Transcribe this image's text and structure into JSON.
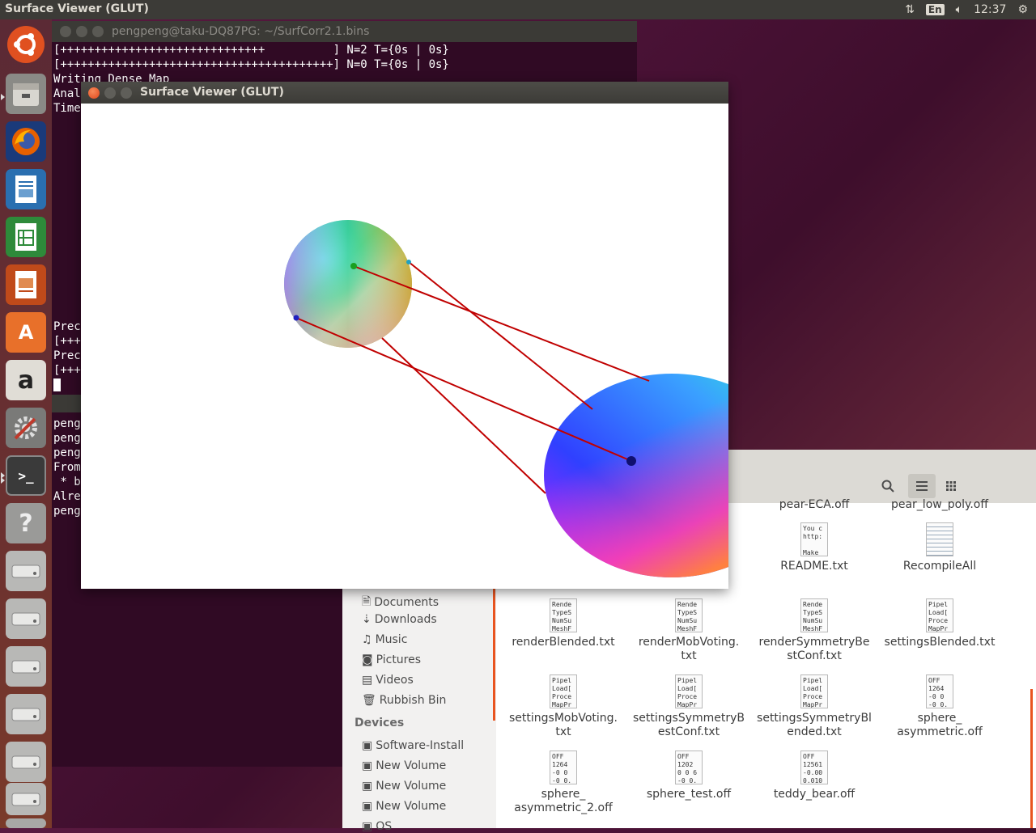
{
  "top_panel": {
    "title": "Surface Viewer (GLUT)",
    "keyboard_layout": "En",
    "time": "12:37"
  },
  "launcher": {
    "items": [
      "Ubuntu",
      "Files",
      "Firefox",
      "Writer",
      "Calc",
      "Impress",
      "Software Center",
      "Amazon",
      "System Settings",
      "Terminal",
      "Help",
      "Drive",
      "Drive",
      "Drive",
      "Drive",
      "Drive",
      "Drive",
      "Rubbish Bin"
    ]
  },
  "terminal": {
    "title": "pengpeng@taku-DQ87PG: ~/SurfCorr2.1.bins",
    "lines": [
      "[++++++++++++++++++++++++++++++          ] N=2 T={0s | 0s}",
      "[++++++++++++++++++++++++++++++++++++++++] N=0 T={0s | 0s}",
      "Writing Dense Map",
      "Anal",
      "Time"
    ],
    "lines_lower": [
      "Prec",
      "[+++",
      "Prec",
      "[+++"
    ],
    "terminal2_lines": [
      "peng",
      "peng",
      "peng",
      "From",
      " * b",
      "Alre",
      "peng"
    ]
  },
  "viewer": {
    "title": "Surface Viewer (GLUT)"
  },
  "files": {
    "sidebar": {
      "places": [
        "Documents",
        "Downloads",
        "Music",
        "Pictures",
        "Videos",
        "Rubbish Bin"
      ],
      "devices_heading": "Devices",
      "devices": [
        "Software-Install",
        "New Volume",
        "New Volume",
        "New Volume",
        "OS"
      ]
    },
    "partial_label": "y.",
    "items": [
      {
        "name": "pear-ECA.off",
        "thumb": ""
      },
      {
        "name": "pear_low_poly.off",
        "thumb": ""
      },
      {
        "name": "README.txt",
        "thumb": "You c\nhttp:\n\nMake"
      },
      {
        "name": "RecompileAll",
        "thumb": ""
      },
      {
        "name": "renderBlended.txt",
        "thumb": "Rende\nTypeS\nNumSu\nMeshF"
      },
      {
        "name": "renderMobVoting.\ntxt",
        "thumb": "Rende\nTypeS\nNumSu\nMeshF"
      },
      {
        "name": "renderSymmetryBe\nstConf.txt",
        "thumb": "Rende\nTypeS\nNumSu\nMeshF"
      },
      {
        "name": "settingsBlended.txt",
        "thumb": "Pipel\nLoad[\nProce\nMapPr"
      },
      {
        "name": "settingsMobVoting.\ntxt",
        "thumb": "Pipel\nLoad[\nProce\nMapPr"
      },
      {
        "name": "settingsSymmetryB\nestConf.txt",
        "thumb": "Pipel\nLoad[\nProce\nMapPr"
      },
      {
        "name": "settingsSymmetryBl\nended.txt",
        "thumb": "Pipel\nLoad[\nProce\nMapPr"
      },
      {
        "name": "sphere_\nasymmetric.off",
        "thumb": "OFF\n1264\n-0 0\n-0 0."
      },
      {
        "name": "sphere_\nasymmetric_2.off",
        "thumb": "OFF\n1264\n-0 0\n-0 0."
      },
      {
        "name": "sphere_test.off",
        "thumb": "OFF\n1202\n0 0 6\n-0 0."
      },
      {
        "name": "teddy_bear.off",
        "thumb": "OFF\n12561\n-0.00\n0.010"
      }
    ]
  },
  "colors": {
    "panel": "#3c3b37",
    "terminal_bg": "#300a24",
    "close_button": "#e95420",
    "correspondence_line": "#c00000"
  }
}
